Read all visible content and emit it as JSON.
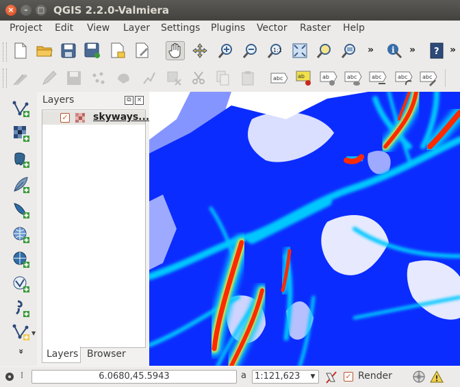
{
  "window": {
    "title": "QGIS 2.2.0-Valmiera",
    "close_glyph": "×",
    "min_glyph": "–",
    "max_glyph": "□"
  },
  "menubar": {
    "items": [
      "Project",
      "Edit",
      "View",
      "Layer",
      "Settings",
      "Plugins",
      "Vector",
      "Raster",
      "Help"
    ]
  },
  "toolbar1": {
    "buttons": [
      "new-project",
      "open-project",
      "save-project",
      "save-as",
      "new-print-composer",
      "composer-manager",
      "pan-map",
      "pan-to-selection",
      "zoom-in",
      "zoom-out",
      "zoom-actual-size",
      "zoom-full",
      "zoom-to-selection",
      "zoom-to-layer",
      "identify-features",
      "help-contents"
    ],
    "overflow_glyph": "»"
  },
  "toolbar2": {
    "buttons": [
      "current-edits",
      "toggle-editing",
      "save-layer-edits",
      "add-feature",
      "move-feature",
      "node-tool",
      "delete-selected",
      "cut-features",
      "copy-features",
      "paste-features",
      "label-tool",
      "pin-labels",
      "show-hide-labels",
      "move-label",
      "rotate-label",
      "change-label"
    ],
    "label_glyph": "abc"
  },
  "left_toolbar": {
    "buttons": [
      "add-vector-layer",
      "add-raster-layer",
      "add-postgis-layer",
      "add-spatialite-layer",
      "add-mssql-layer",
      "add-wms-layer",
      "add-wcs-layer",
      "add-wfs-layer",
      "add-delimited-text-layer",
      "new-shapefile-layer"
    ],
    "overflow_glyph": "»"
  },
  "layers_panel": {
    "title": "Layers",
    "float_glyph": "⧉",
    "close_glyph": "×",
    "layers": [
      {
        "name": "skyways...",
        "visible": true,
        "checked_glyph": "✓"
      }
    ],
    "tabs": [
      "Layers",
      "Browser"
    ],
    "active_tab": "Layers"
  },
  "map": {
    "layer": "skyways",
    "style": "heatmap",
    "colors": [
      "#ffffff",
      "#0b2cff",
      "#00c8ff",
      "#ff2a00"
    ]
  },
  "statusbar": {
    "coord_label": "⁞",
    "coordinates": "6.0680,45.5943",
    "scale_label": "a",
    "scale": "1:121,623",
    "scale_dropdown_glyph": "▼",
    "render_label": "Render",
    "render_checked": true,
    "render_checked_glyph": "✓"
  }
}
